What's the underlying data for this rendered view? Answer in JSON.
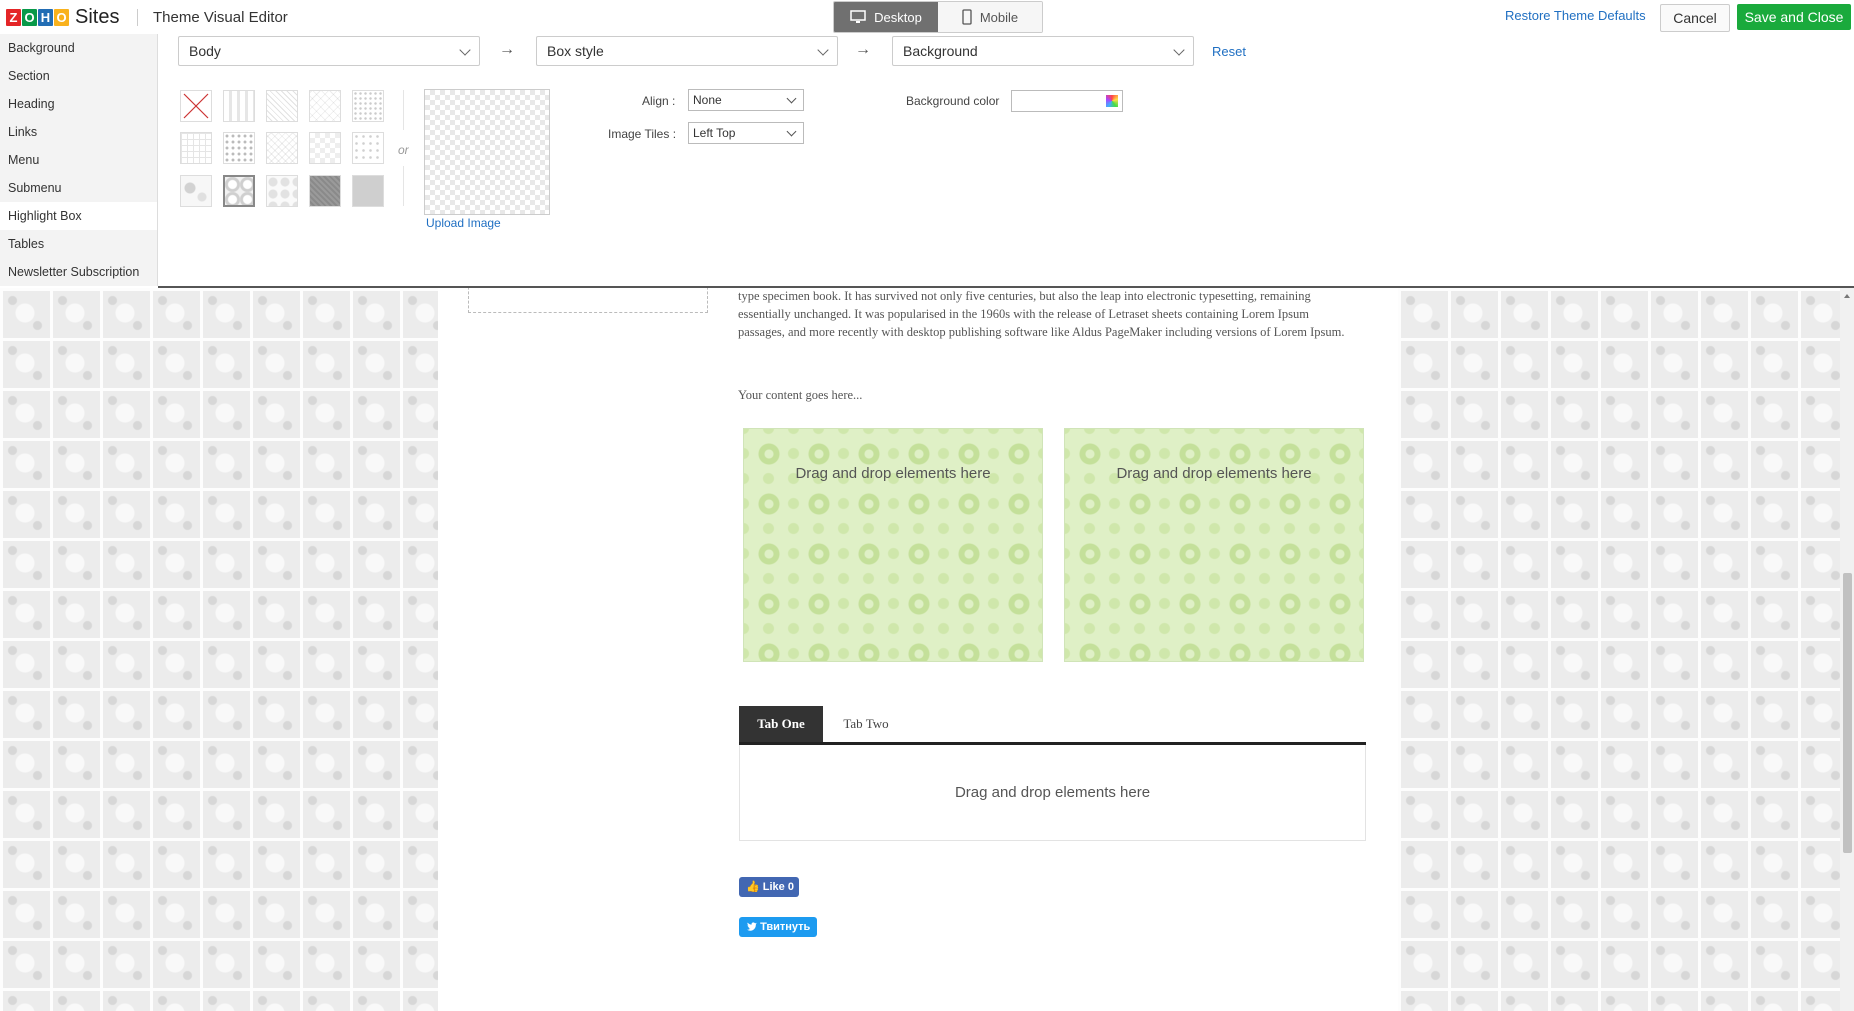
{
  "app": {
    "logo_letters": [
      "Z",
      "O",
      "H",
      "O"
    ],
    "logo_colors": [
      "#e42527",
      "#089949",
      "#226db4",
      "#f9b21d"
    ],
    "product": "Sites",
    "title": "Theme Visual Editor"
  },
  "device_switch": {
    "desktop": "Desktop",
    "mobile": "Mobile",
    "active": "desktop"
  },
  "actions": {
    "restore": "Restore Theme Defaults",
    "cancel": "Cancel",
    "save": "Save and Close"
  },
  "sidebar": {
    "items": [
      {
        "label": "Background"
      },
      {
        "label": "Section"
      },
      {
        "label": "Heading"
      },
      {
        "label": "Links"
      },
      {
        "label": "Menu"
      },
      {
        "label": "Submenu"
      },
      {
        "label": "Highlight Box",
        "active": true
      },
      {
        "label": "Tables"
      },
      {
        "label": "Newsletter Subscription"
      }
    ]
  },
  "editor": {
    "selectors": [
      "Body",
      "Box style",
      "Background"
    ],
    "arrow": "→",
    "reset": "Reset",
    "or_text": "or",
    "upload": "Upload Image",
    "align_label": "Align :",
    "align_value": "None",
    "tiles_label": "Image Tiles :",
    "tiles_value": "Left Top",
    "bgcolor_label": "Background color",
    "patterns": [
      "none",
      "vertical-stripes",
      "diagonal-lines",
      "diamond-grid",
      "dot-grid",
      "fine-grid",
      "dots",
      "crosshatch",
      "checker",
      "small-dots",
      "floral-light",
      "floral-selected",
      "floral-outline",
      "dark-texture",
      "gray-solid"
    ],
    "selected_pattern_index": 11
  },
  "canvas": {
    "paragraph": "type specimen book. It has survived not only five centuries, but also the leap into electronic typesetting, remaining essentially unchanged. It was popularised in the 1960s with the release of Letraset sheets containing Lorem Ipsum passages, and more recently with desktop publishing software like Aldus PageMaker including versions of Lorem Ipsum.",
    "your_content": "Your content goes here...",
    "drop_label": "Drag and drop elements here",
    "tabs": [
      "Tab One",
      "Tab Two"
    ],
    "fb_like": "Like 0",
    "tweet": "Твитнуть"
  }
}
